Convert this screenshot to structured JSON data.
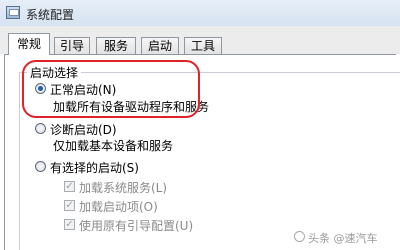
{
  "window": {
    "title": "系统配置"
  },
  "tabs": [
    {
      "label": "常规",
      "active": true
    },
    {
      "label": "引导",
      "active": false
    },
    {
      "label": "服务",
      "active": false
    },
    {
      "label": "启动",
      "active": false
    },
    {
      "label": "工具",
      "active": false
    }
  ],
  "startup_selection": {
    "group_title": "启动选择",
    "normal": {
      "label": "正常启动(N)",
      "description": "加载所有设备驱动程序和服务",
      "selected": true
    },
    "diagnostic": {
      "label": "诊断启动(D)",
      "description": "仅加载基本设备和服务",
      "selected": false
    },
    "selective": {
      "label": "有选择的启动(S)",
      "selected": false,
      "options": [
        {
          "label": "加载系统服务(L)",
          "checked": true,
          "enabled": false
        },
        {
          "label": "加载启动项(O)",
          "checked": true,
          "enabled": false
        },
        {
          "label": "使用原有引导配置(U)",
          "checked": true,
          "enabled": false
        }
      ]
    }
  },
  "annotation": {
    "color": "#e0222a"
  },
  "watermark": {
    "text": "头条 @速汽车"
  }
}
